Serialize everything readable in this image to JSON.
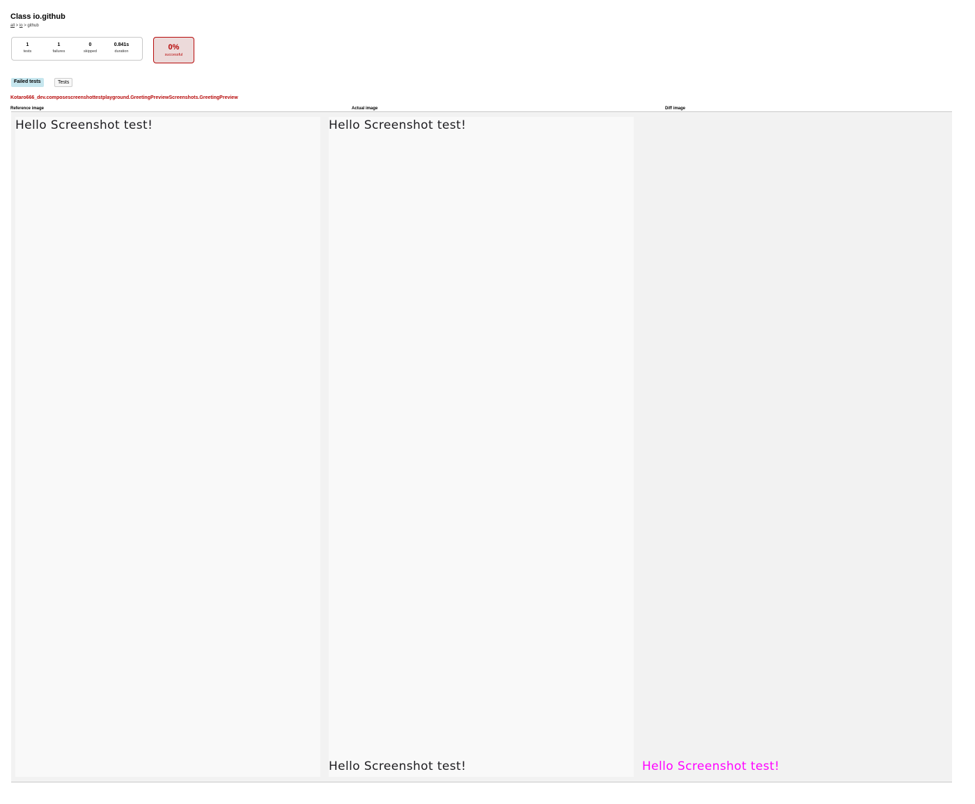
{
  "header": {
    "title": "Class io.github",
    "breadcrumb": {
      "all": "all",
      "sep1": " > ",
      "io": "io",
      "sep2": " > github"
    }
  },
  "summary": {
    "tests": {
      "value": "1",
      "label": "tests"
    },
    "failures": {
      "value": "1",
      "label": "failures"
    },
    "skipped": {
      "value": "0",
      "label": "skipped"
    },
    "duration": {
      "value": "0.841s",
      "label": "duration"
    }
  },
  "success_rate": {
    "value": "0%",
    "label": "successful"
  },
  "tabs": [
    {
      "label": "Failed tests"
    },
    {
      "label": "Tests"
    }
  ],
  "failed_test": {
    "name": "Kotaro666_dev.composescreenshottestplayground.GreetingPreviewScreenshots.GreetingPreview",
    "columns": [
      "Reference image",
      "Actual image",
      "Diff image"
    ],
    "reference_text": "Hello Screenshot test!",
    "actual_text_top": "Hello Screenshot test!",
    "actual_text_bottom": "Hello Screenshot test!",
    "diff_text": "Hello Screenshot test!"
  },
  "colors": {
    "failure": "#b60808",
    "diff_highlight": "#ff00ff",
    "tab_selected": "#c6e6ee"
  }
}
